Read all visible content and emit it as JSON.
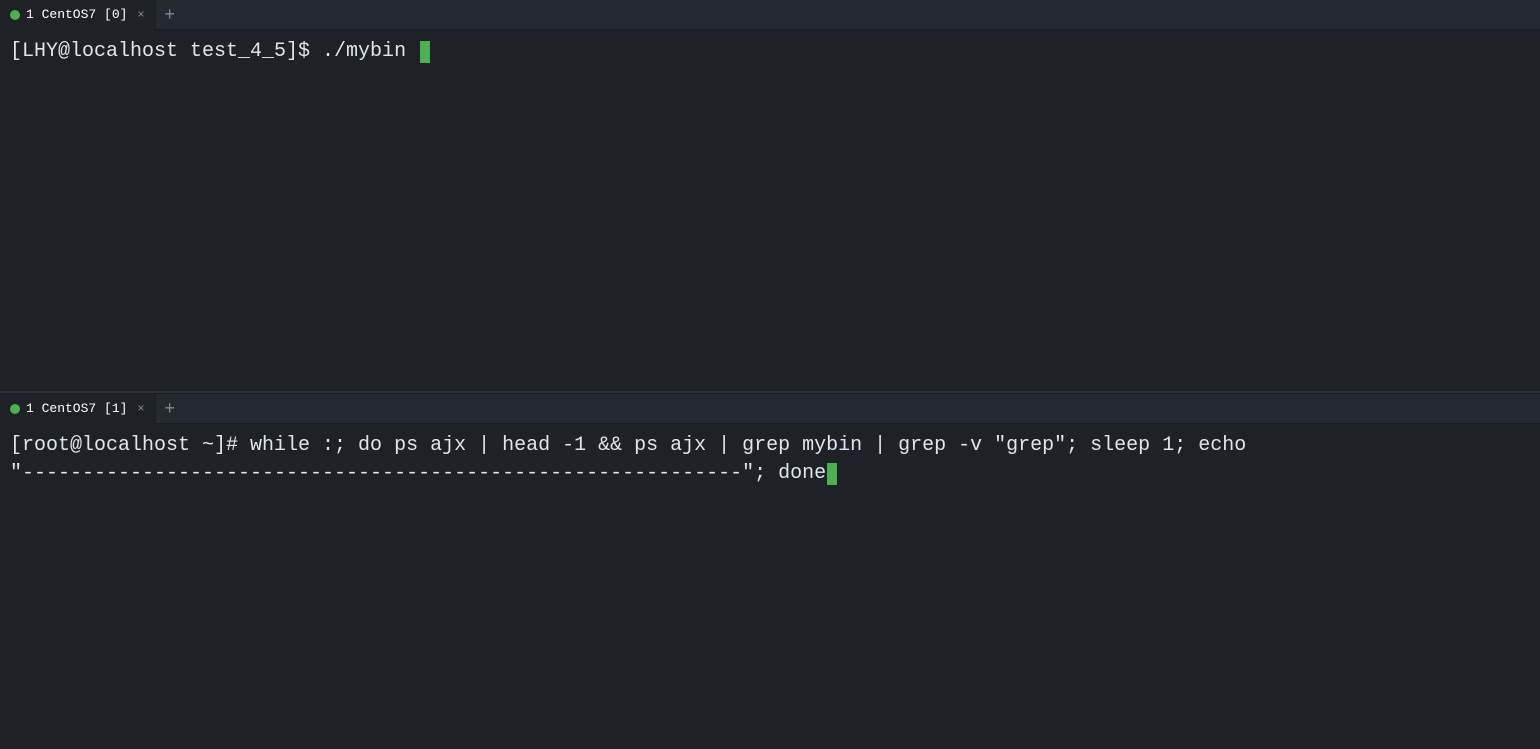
{
  "pane_top": {
    "tab_label": "1 CentOS7 [0]",
    "prompt": "[LHY@localhost test_4_5]$ ./mybin ",
    "content": ""
  },
  "pane_bottom": {
    "tab_label": "1 CentOS7 [1]",
    "line1": "[root@localhost ~]# while :; do ps ajx | head -1 && ps ajx | grep mybin | grep -v \"grep\"; sleep 1; echo",
    "line2": "\"------------------------------------------------------------\"; done",
    "content": ""
  },
  "tab_add": "+",
  "close_x": "×"
}
